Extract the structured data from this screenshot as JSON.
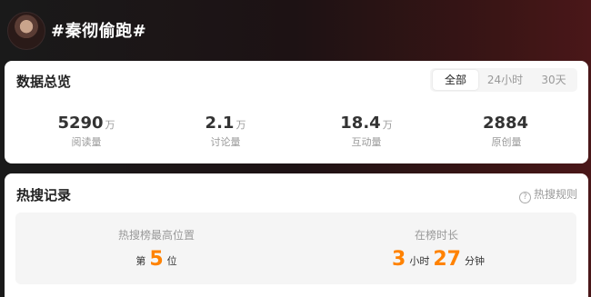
{
  "header": {
    "title": "#秦彻偷跑#"
  },
  "overview": {
    "title": "数据总览",
    "tabs": [
      "全部",
      "24小时",
      "30天"
    ],
    "active_tab": "全部",
    "stats": [
      {
        "value": "5290",
        "unit": "万",
        "label": "阅读量"
      },
      {
        "value": "2.1",
        "unit": "万",
        "label": "讨论量"
      },
      {
        "value": "18.4",
        "unit": "万",
        "label": "互动量"
      },
      {
        "value": "2884",
        "unit": "",
        "label": "原创量"
      }
    ]
  },
  "hot_search": {
    "title": "热搜记录",
    "rules_label": "热搜规则",
    "help_icon": "?",
    "peak": {
      "label": "热搜榜最高位置",
      "prefix": "第",
      "value": "5",
      "suffix": "位"
    },
    "duration": {
      "label": "在榜时长",
      "hours": "3",
      "hours_unit": "小时",
      "minutes": "27",
      "minutes_unit": "分钟"
    }
  },
  "colors": {
    "accent_orange": "#ff8200",
    "header_bg_left": "#1a1a1a",
    "header_bg_right": "#4a1719"
  }
}
